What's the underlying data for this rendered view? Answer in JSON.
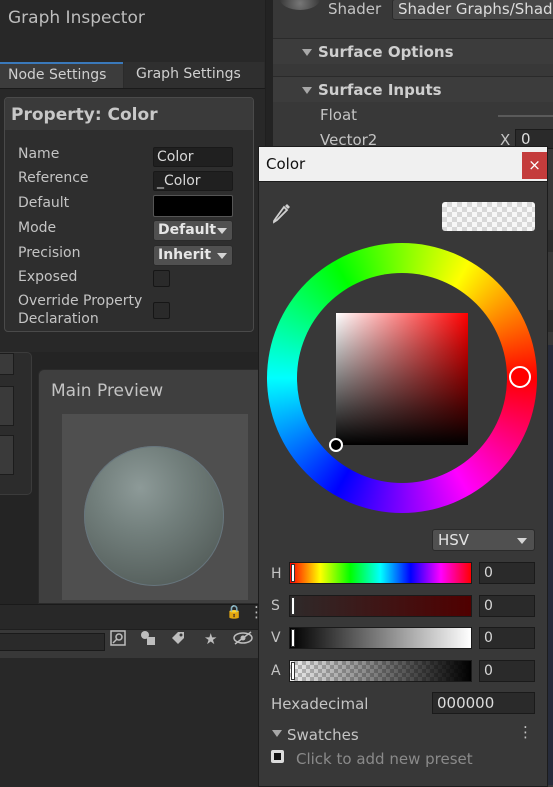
{
  "graph_inspector": {
    "title": "Graph Inspector",
    "tabs": [
      "Node Settings",
      "Graph Settings"
    ],
    "property_panel": {
      "title": "Property: Color",
      "rows": {
        "name": {
          "label": "Name",
          "value": "Color"
        },
        "reference": {
          "label": "Reference",
          "value": "_Color"
        },
        "default": {
          "label": "Default",
          "color": "#000000"
        },
        "mode": {
          "label": "Mode",
          "value": "Default"
        },
        "precision": {
          "label": "Precision",
          "value": "Inherit"
        },
        "exposed": {
          "label": "Exposed",
          "checked": false
        },
        "override": {
          "label_line1": "Override Property",
          "label_line2": "Declaration",
          "checked": false
        }
      }
    }
  },
  "inspector": {
    "shader_label": "Shader",
    "shader_value": "Shader Graphs/Shader",
    "sections": [
      "Surface Options",
      "Surface Inputs"
    ],
    "float_label": "Float",
    "vector2_label": "Vector2",
    "vector2_x_label": "X",
    "vector2_x_value": "0"
  },
  "main_preview": {
    "title": "Main Preview"
  },
  "color_picker": {
    "title": "Color",
    "close_glyph": "×",
    "mode": "HSV",
    "sliders": [
      {
        "label": "H",
        "value": "0"
      },
      {
        "label": "S",
        "value": "0"
      },
      {
        "label": "V",
        "value": "0"
      },
      {
        "label": "A",
        "value": "0"
      }
    ],
    "hex_label": "Hexadecimal",
    "hex_value": "000000",
    "swatches_label": "Swatches",
    "swatches_menu_glyph": "⋮",
    "preset_hint": "Click to add new preset",
    "current_color": "#000000"
  },
  "toolbar": {
    "lock_glyph": "🔒",
    "menu_glyph": "⋮",
    "star_glyph": "★"
  }
}
